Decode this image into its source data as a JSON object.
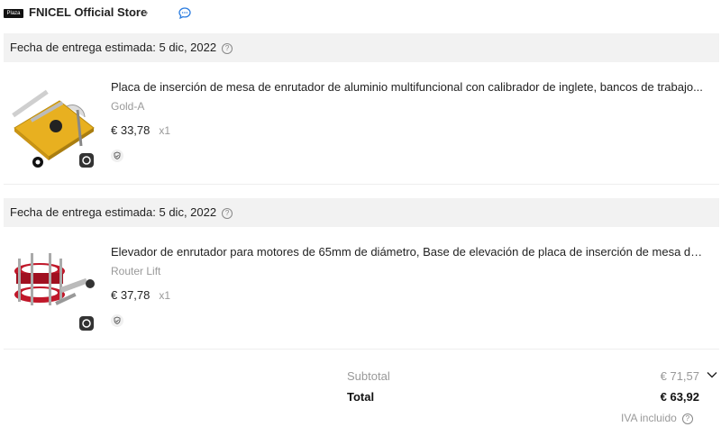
{
  "store": {
    "badge": "Plaza",
    "name": "FNICEL Official Store",
    "chevron": "›",
    "chat_icon": "chat-bubble-icon"
  },
  "items": [
    {
      "delivery": "Fecha de entrega estimada: 5 dic, 2022",
      "title": "Placa de inserción de mesa de enrutador de aluminio multifuncional con calibrador de inglete, bancos de trabajo...",
      "variant": "Gold-A",
      "price": "€ 33,78",
      "qty": "x1",
      "accent": "#e8b020"
    },
    {
      "delivery": "Fecha de entrega estimada: 5 dic, 2022",
      "title": "Elevador de enrutador para motores de 65mm de diámetro, Base de elevación de placa de inserción de mesa de ...",
      "variant": "Router Lift",
      "price": "€ 37,78",
      "qty": "x1",
      "accent": "#c0182a"
    }
  ],
  "summary": {
    "subtotal_label": "Subtotal",
    "subtotal_value": "€ 71,57",
    "total_label": "Total",
    "total_value": "€ 63,92",
    "vat_label": "IVA incluido"
  }
}
